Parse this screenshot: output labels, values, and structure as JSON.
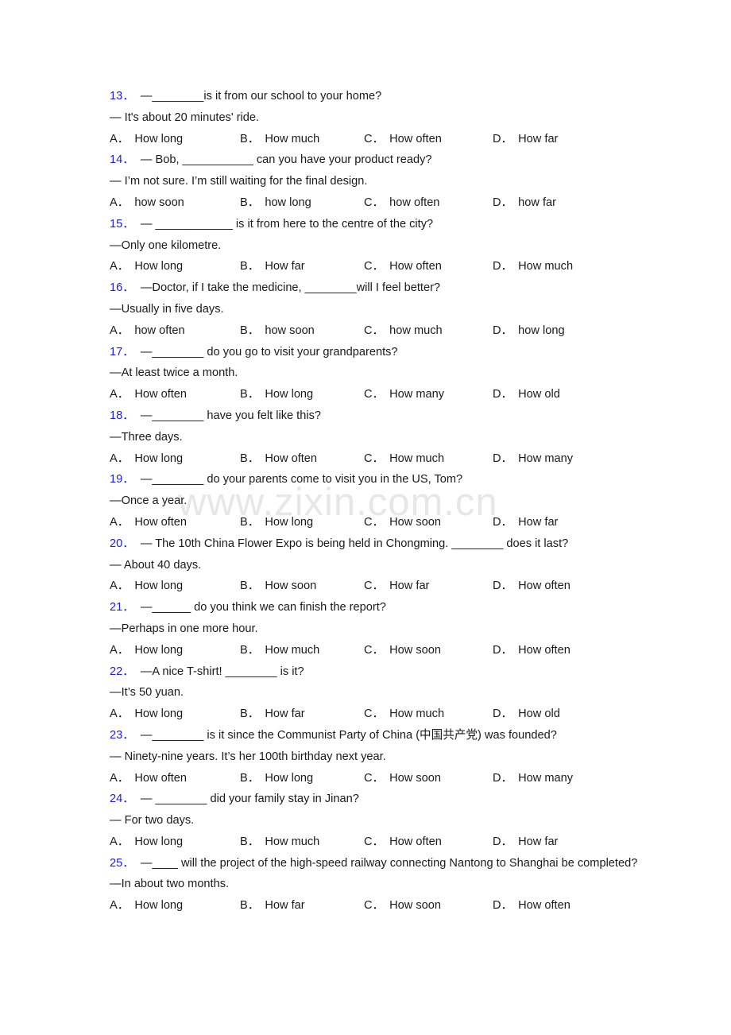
{
  "document": {
    "type": "english-grammar-exercise-worksheet",
    "watermark": "www.zixin.com.cn",
    "option_letters": [
      "A．",
      "B．",
      "C．",
      "D．"
    ]
  },
  "questions": [
    {
      "number": "13．",
      "stem": "—________is it from our school to your home?",
      "answer": "— It's about 20 minutes' ride.",
      "options": [
        "How long",
        "How much",
        "How often",
        "How far"
      ]
    },
    {
      "number": "14．",
      "stem": "— Bob, ___________ can you have your product ready?",
      "answer": "— I’m not sure. I’m still waiting for the final design.",
      "options": [
        "how soon",
        "how long",
        "how often",
        "how far"
      ]
    },
    {
      "number": "15．",
      "stem": "— ____________ is it from here to the centre of the city?",
      "answer": "—Only one kilometre.",
      "options": [
        "How long",
        "How far",
        "How often",
        "How much"
      ]
    },
    {
      "number": "16．",
      "stem": "—Doctor, if I take the medicine, ________will I feel better?",
      "answer": "—Usually in five days.",
      "options": [
        "how often",
        "how soon",
        "how much",
        "how long"
      ]
    },
    {
      "number": "17．",
      "stem": "—________ do you go to visit your grandparents?",
      "answer": "—At least twice a month.",
      "options": [
        "How often",
        "How long",
        "How many",
        "How old"
      ]
    },
    {
      "number": "18．",
      "stem": "—________ have you felt like this?",
      "answer": "—Three days.",
      "options": [
        "How long",
        "How often",
        "How much",
        "How many"
      ]
    },
    {
      "number": "19．",
      "stem": "—________ do your parents come to visit you in the US, Tom?",
      "answer": "—Once a year.",
      "options": [
        "How often",
        "How long",
        "How soon",
        "How far"
      ]
    },
    {
      "number": "20．",
      "stem": "— The 10th China Flower Expo is being held in Chongming. ________ does it last?",
      "answer": "— About 40 days.",
      "options": [
        "How long",
        "How soon",
        "How far",
        "How often"
      ]
    },
    {
      "number": "21．",
      "stem": "—______ do you think we can finish the report?",
      "answer": "—Perhaps in one more hour.",
      "options": [
        "How long",
        "How much",
        "How soon",
        "How often"
      ]
    },
    {
      "number": "22．",
      "stem": "—A nice T-shirt! ________ is it?",
      "answer": "—It’s 50 yuan.",
      "options": [
        "How long",
        "How far",
        "How much",
        "How old"
      ]
    },
    {
      "number": "23．",
      "stem": "—________ is it since the Communist Party of China (中国共产党) was founded?",
      "answer": "— Ninety-nine years. It’s her 100th birthday next year.",
      "options": [
        "How often",
        "How long",
        "How soon",
        "How many"
      ]
    },
    {
      "number": "24．",
      "stem": "— ________ did your family stay in Jinan?",
      "answer": "— For two days.",
      "options": [
        "How long",
        "How much",
        "How often",
        "How far"
      ]
    },
    {
      "number": "25．",
      "stem": "—____ will the project of the high-speed railway connecting Nantong to Shanghai be completed?",
      "answer": "—In about two months.",
      "options": [
        "How long",
        "How far",
        "How soon",
        "How often"
      ]
    }
  ]
}
